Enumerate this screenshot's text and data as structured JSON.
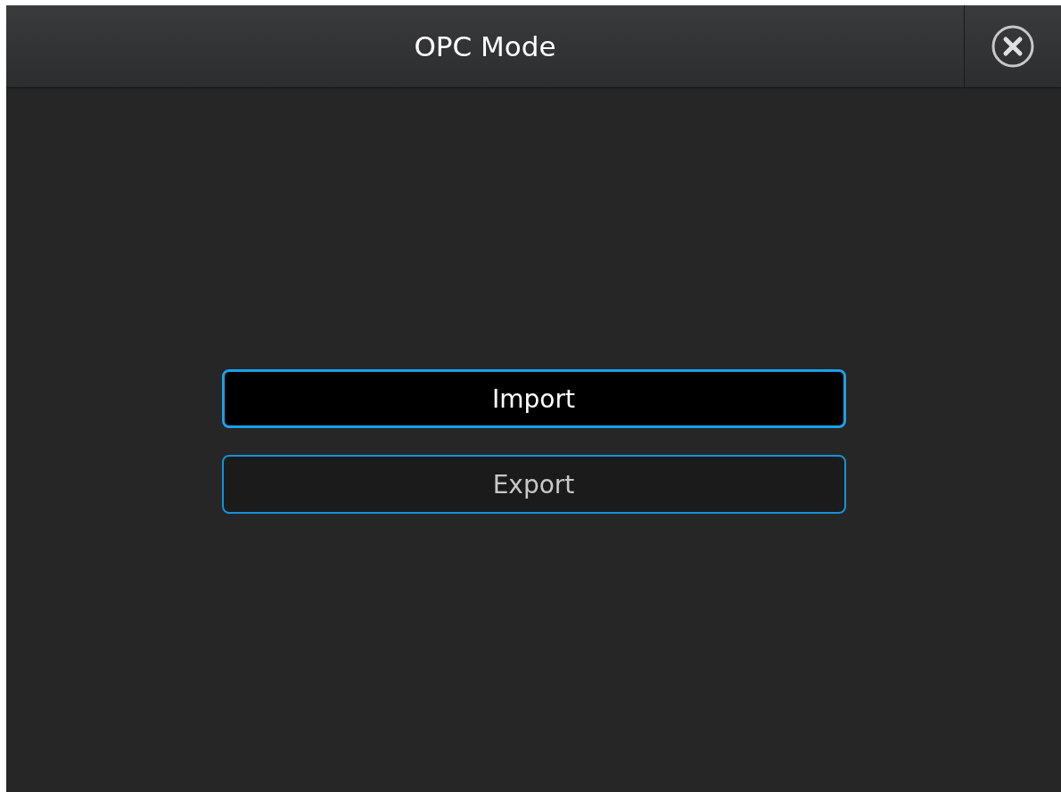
{
  "window": {
    "title": "OPC Mode"
  },
  "buttons": [
    {
      "label": "Import",
      "selected": true
    },
    {
      "label": "Export",
      "selected": false
    }
  ]
}
